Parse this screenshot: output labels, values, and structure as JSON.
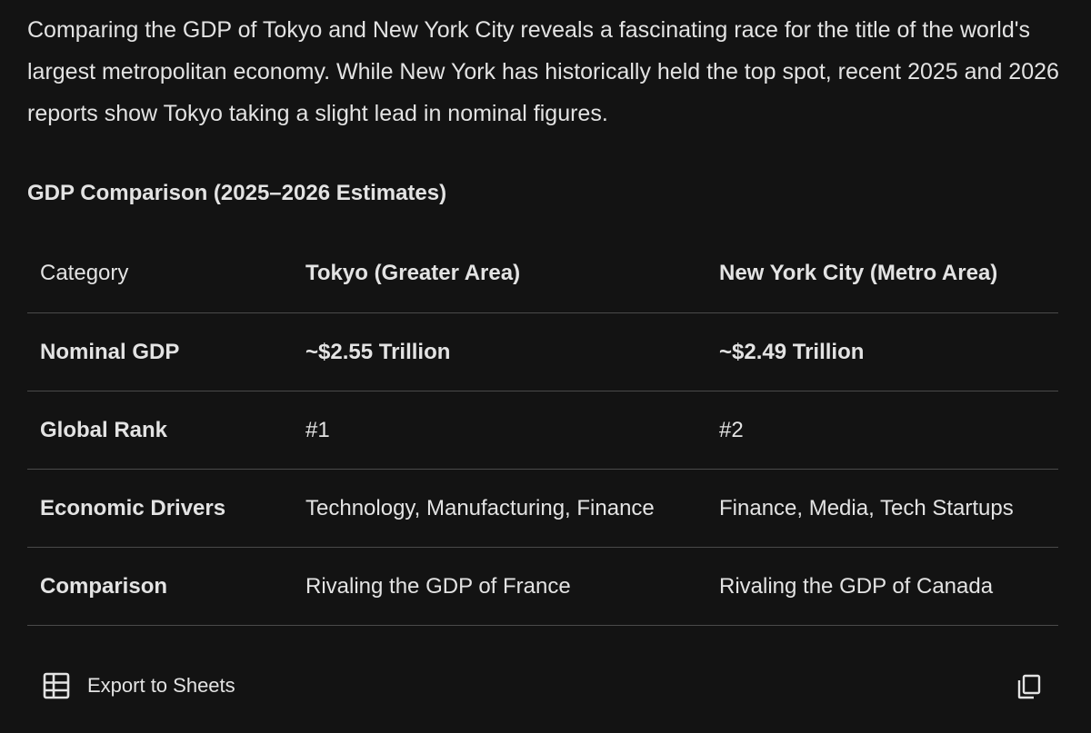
{
  "intro": {
    "text": "Comparing the GDP of Tokyo and New York City reveals a fascinating race for the title of the world's largest metropolitan economy. While New York has historically held the top spot, recent 2025 and 2026 reports show Tokyo taking a slight lead in nominal figures."
  },
  "section": {
    "heading": "GDP Comparison (2025–2026 Estimates)"
  },
  "table": {
    "headers": [
      "Category",
      "Tokyo (Greater Area)",
      "New York City (Metro Area)"
    ],
    "rows": [
      [
        "Nominal GDP",
        "~$2.55 Trillion",
        "~$2.49 Trillion"
      ],
      [
        "Global Rank",
        "#1",
        "#2"
      ],
      [
        "Economic Drivers",
        "Technology, Manufacturing, Finance",
        "Finance, Media, Tech Startups"
      ],
      [
        "Comparison",
        "Rivaling the GDP of France",
        "Rivaling the GDP of Canada"
      ]
    ]
  },
  "toolbar": {
    "export_label": "Export to Sheets",
    "export_icon": "table-grid-icon",
    "copy_icon": "copy-icon"
  }
}
